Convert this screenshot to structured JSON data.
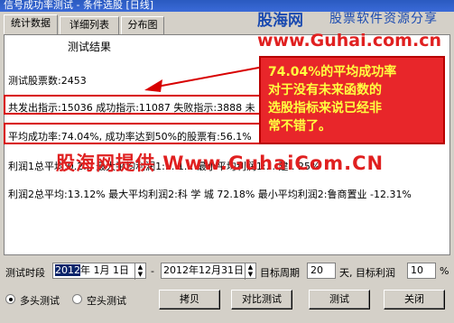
{
  "window": {
    "title": "信号成功率测试 - 条件选股 [日线]"
  },
  "tabs": [
    {
      "label": "统计数据",
      "active": true
    },
    {
      "label": "详细列表",
      "active": false
    },
    {
      "label": "分布图",
      "active": false
    }
  ],
  "results": {
    "title": "测试结果",
    "stock_count": "测试股票数:2453",
    "signals": "共发出指示:15036 成功指示:11087 失败指示:3888 未",
    "success_rate": "平均成功率:74.04%, 成功率达到50%的股票有:56.1%",
    "profit1": "利润1总平均:0.2... 最大平均利润1:...  1... 最小平均利润1:... 建 . 25%",
    "profit2": "利润2总平均:13.12% 最大平均利润2:科 学 城 72.18% 最小平均利润2:鲁商置业 -12.31%"
  },
  "logo": {
    "brand": "股海网",
    "slogan": "股票软件资源分享",
    "url": "www.Guhai.com.cn"
  },
  "callout": {
    "lines": [
      "74.04%的平均成功率",
      "对于没有未来函数的",
      "选股指标来说已经非",
      "常不错了。"
    ]
  },
  "watermark": "股海网提供 Www.GuhaiCom.CN",
  "controls": {
    "period_label": "测试时段",
    "start_date": {
      "year": "2012",
      "rest": "年 1月 1日"
    },
    "dash": "-",
    "end_date": "2012年12月31日",
    "target_period_label": "目标周期",
    "target_period_value": "20",
    "target_profit_label": "天, 目标利润",
    "target_profit_value": "10",
    "percent": "%",
    "radio_long": "多头测试",
    "radio_short": "空头测试",
    "copy_button": "拷贝",
    "compare_button": "对比测试",
    "test_button": "测试",
    "close_button": "关闭"
  },
  "colors": {
    "accent_red": "#e02020",
    "callout_text": "#ffff40",
    "brand_blue": "#1a4ab0"
  }
}
